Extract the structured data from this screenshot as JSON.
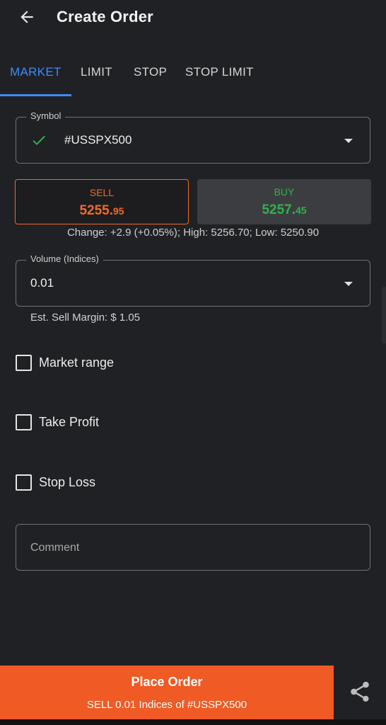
{
  "header": {
    "title": "Create Order"
  },
  "tabs": [
    {
      "label": "MARKET",
      "active": true
    },
    {
      "label": "LIMIT",
      "active": false
    },
    {
      "label": "STOP",
      "active": false
    },
    {
      "label": "STOP LIMIT",
      "active": false
    }
  ],
  "symbol": {
    "label": "Symbol",
    "value": "#USSPX500"
  },
  "sell": {
    "label": "SELL",
    "price_main": "5255.",
    "price_small": "95"
  },
  "buy": {
    "label": "BUY",
    "price_main": "5257.",
    "price_small": "45"
  },
  "change_text": "Change: +2.9 (+0.05%); High: 5256.70; Low: 5250.90",
  "volume": {
    "label": "Volume (Indices)",
    "value": "0.01"
  },
  "margin_text": "Est. Sell Margin: $ 1.05",
  "checkboxes": [
    {
      "label": "Market range",
      "checked": false
    },
    {
      "label": "Take Profit",
      "checked": false
    },
    {
      "label": "Stop Loss",
      "checked": false
    }
  ],
  "comment": {
    "placeholder": "Comment"
  },
  "place_order": {
    "title": "Place Order",
    "subtitle": "SELL 0.01 Indices of #USSPX500"
  },
  "icons": {
    "back": "arrow-left-icon",
    "check": "check-icon",
    "share": "share-icon",
    "dropdown": "chevron-down-icon"
  },
  "colors": {
    "accent": "#3d8bff",
    "sell": "#f06a2c",
    "buy": "#2fb34a",
    "order_button": "#f05a24",
    "background": "#202124"
  }
}
